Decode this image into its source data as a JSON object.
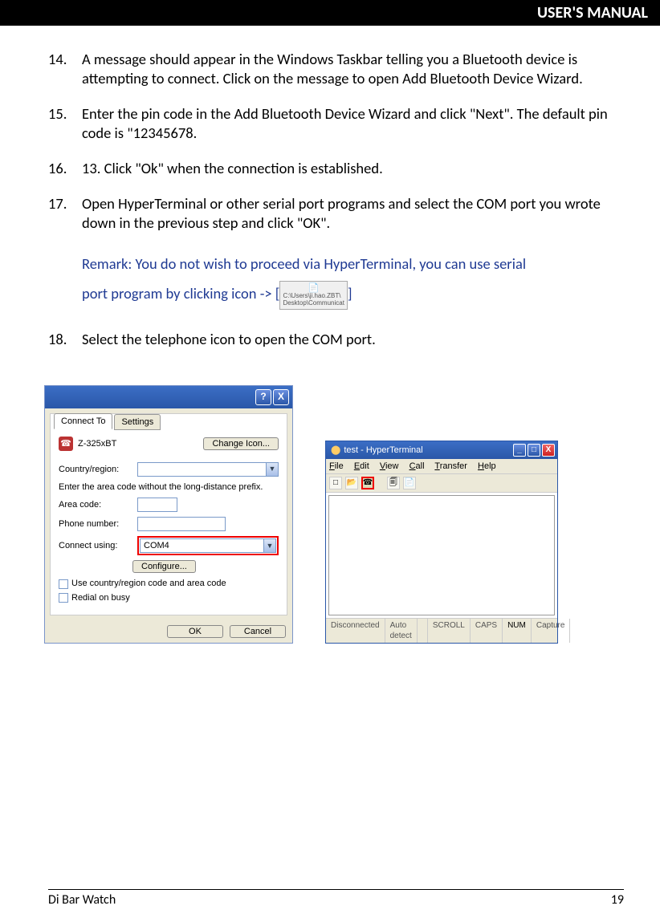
{
  "header": {
    "title": "USER'S MANUAL"
  },
  "steps": [
    {
      "num": "14.",
      "text": "A message should appear in the Windows Taskbar telling you a Bluetooth device is attempting to connect. Click on the message to open Add Bluetooth Device Wizard."
    },
    {
      "num": "15.",
      "text": "Enter the pin code in the Add Bluetooth Device Wizard and click \"Next\". The default pin code is \"12345678."
    },
    {
      "num": "16.",
      "text": "13. Click \"Ok\" when the connection is established."
    },
    {
      "num": "17.",
      "text": "Open HyperTerminal or other serial port programs and select the COM port you wrote down in the previous step and click \"OK\"."
    },
    {
      "num": "18.",
      "text": "Select the telephone icon to open the COM port."
    }
  ],
  "remark": {
    "line1": "Remark: You do not wish to proceed via HyperTerminal, you can use serial",
    "line2a": "port program by clicking icon -> [",
    "line2b": "]",
    "icon_line1": "C:\\Users\\ji.hao.ZBT\\",
    "icon_line2": "Desktop\\Communicat"
  },
  "dlg1": {
    "help": "?",
    "close": "X",
    "tab1": "Connect To",
    "tab2": "Settings",
    "device": "Z-325xBT",
    "change_icon": "Change Icon...",
    "country_label": "Country/region:",
    "area_hint": "Enter the area code without the long-distance prefix.",
    "area_label": "Area code:",
    "phone_label": "Phone number:",
    "connect_label": "Connect using:",
    "connect_value": "COM4",
    "configure": "Configure...",
    "cb1": "Use country/region code and area code",
    "cb2": "Redial on busy",
    "ok": "OK",
    "cancel": "Cancel"
  },
  "dlg2": {
    "title": "test - HyperTerminal",
    "menu": {
      "file": "File",
      "edit": "Edit",
      "view": "View",
      "call": "Call",
      "transfer": "Transfer",
      "help": "Help"
    },
    "status": {
      "s1": "Disconnected",
      "s2": "Auto detect",
      "s3": "SCROLL",
      "s4": "CAPS",
      "s5": "NUM",
      "s6": "Capture"
    }
  },
  "footer": {
    "left": "Di Bar Watch",
    "right": "19"
  }
}
